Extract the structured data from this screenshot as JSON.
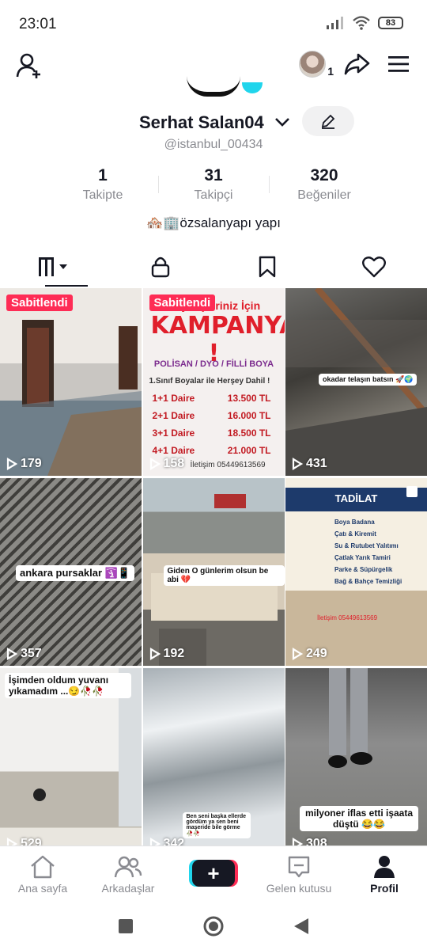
{
  "status": {
    "time": "23:01",
    "battery": "83"
  },
  "profile": {
    "username": "Serhat Salan04",
    "handle": "@istanbul_00434",
    "bio": "🏘️🏢özsalanyapı yapı",
    "notification_count": "1"
  },
  "stats": [
    {
      "value": "1",
      "label": "Takipte"
    },
    {
      "value": "31",
      "label": "Takipçi"
    },
    {
      "value": "320",
      "label": "Beğeniler"
    }
  ],
  "tabs": [
    {
      "name": "videos",
      "icon": "grid-icon",
      "active": true
    },
    {
      "name": "private",
      "icon": "lock-icon"
    },
    {
      "name": "saved",
      "icon": "bookmark-icon"
    },
    {
      "name": "liked",
      "icon": "heart-icon"
    }
  ],
  "videos": [
    {
      "views": "179",
      "pinned": "Sabitlendi"
    },
    {
      "views": "158",
      "pinned": "Sabitlendi",
      "title": "KAMPANYA !",
      "header": "Boya İşleriniz İçin",
      "brands": "POLİSAN / DYO / FİLLİ BOYA",
      "note": "1.Sınıf Boyalar ile Herşey Dahil !",
      "prices": [
        {
          "label": "1+1 Daire",
          "price": "13.500 TL"
        },
        {
          "label": "2+1 Daire",
          "price": "16.000 TL"
        },
        {
          "label": "3+1 Daire",
          "price": "18.500 TL"
        },
        {
          "label": "4+1 Daire",
          "price": "21.000 TL"
        }
      ],
      "phone": "İletişim 05449613569"
    },
    {
      "views": "431",
      "caption": "okadar telaşın batsın 🚀🌍"
    },
    {
      "views": "357",
      "caption": "ankara pursaklar 🛐📱"
    },
    {
      "views": "192",
      "caption": "Giden O günlerim olsun be abi 💔"
    },
    {
      "views": "249",
      "title": "TADİLAT",
      "services": [
        "Boya Badana",
        "Çatı & Kiremit",
        "Su & Rutubet Yalıtımı",
        "Çatlak Yarık Tamiri",
        "Parke & Süpürgelik",
        "Bağ & Bahçe Temizliği"
      ],
      "phone": "İletişim 05449613569"
    },
    {
      "views": "529",
      "caption": "İşimden oldum yuvanı yıkamadım ...😏🥀🥀"
    },
    {
      "views": "342",
      "caption": "Ben seni başka ellerde gördüm ya sen beni maşeride bile görme 🥀🥀"
    },
    {
      "views": "308",
      "caption": "milyoner iflas etti işaata düştü 😂😂"
    }
  ],
  "nav": [
    {
      "label": "Ana sayfa",
      "icon": "home-icon"
    },
    {
      "label": "Arkadaşlar",
      "icon": "friends-icon"
    },
    {
      "label": "",
      "icon": "plus-icon"
    },
    {
      "label": "Gelen kutusu",
      "icon": "inbox-icon"
    },
    {
      "label": "Profil",
      "icon": "profile-icon",
      "active": true
    }
  ]
}
